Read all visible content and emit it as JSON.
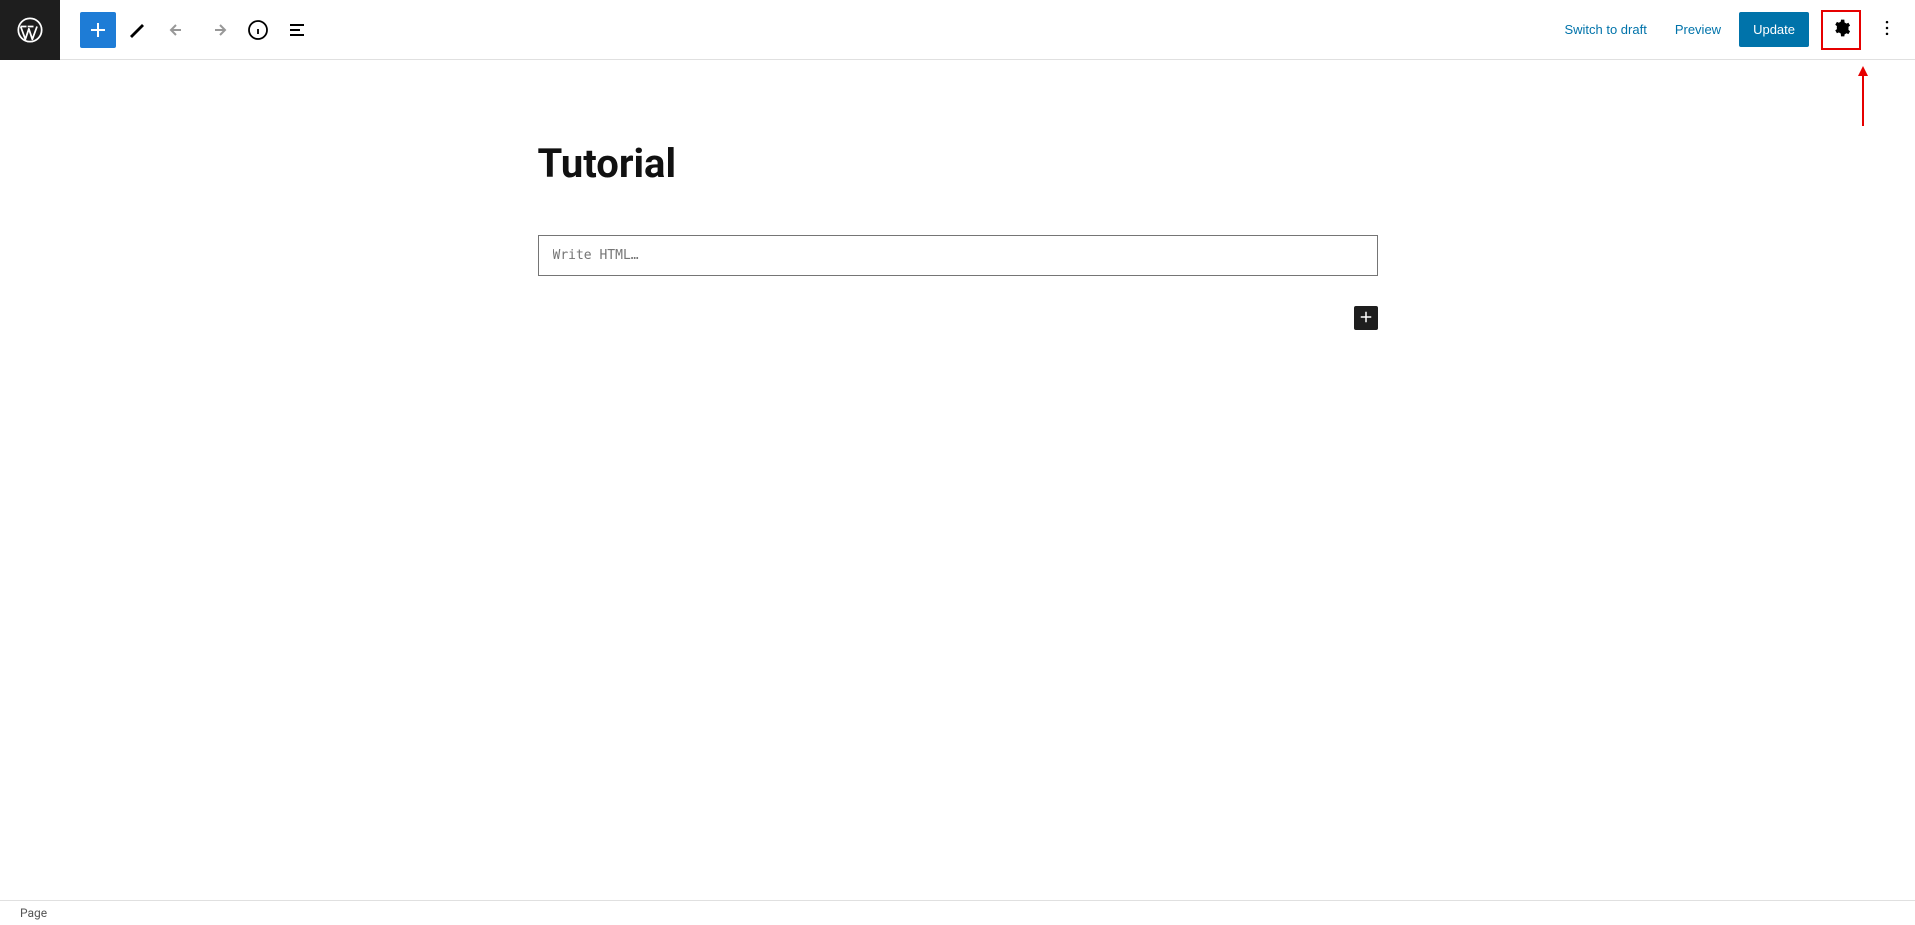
{
  "header": {
    "switch_to_draft": "Switch to draft",
    "preview": "Preview",
    "update": "Update"
  },
  "editor": {
    "title": "Tutorial",
    "html_placeholder": "Write HTML…"
  },
  "footer": {
    "breadcrumb": "Page"
  }
}
